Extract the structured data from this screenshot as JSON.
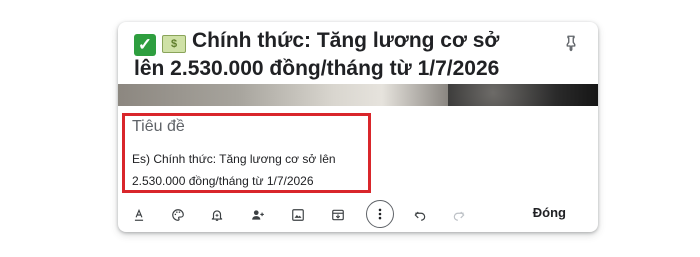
{
  "note": {
    "title": "Chính thức: Tăng lương cơ sở lên 2.530.000 đồng/tháng từ 1/7/2026",
    "field_label": "Tiêu đề",
    "body_line1": "Es) Chính thức: Tăng lương cơ sở lên",
    "body_line2": "2.530.000 đồng/tháng từ 1/7/2026"
  },
  "icons": {
    "title_emojis": [
      "check-mark-emoji",
      "money-emoji"
    ],
    "pin": "pin-icon"
  },
  "toolbar": {
    "items": [
      "text-format-icon",
      "palette-icon",
      "reminder-icon",
      "collaborator-icon",
      "image-icon",
      "archive-icon",
      "more-icon",
      "undo-icon",
      "redo-icon"
    ],
    "close_label": "Đóng"
  },
  "colors": {
    "highlight_border": "#d9262b",
    "text_primary": "#202124",
    "text_secondary": "#5f6368"
  }
}
